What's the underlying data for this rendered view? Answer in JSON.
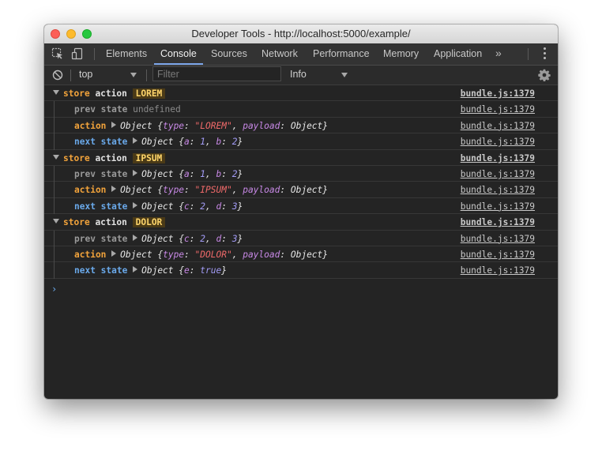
{
  "window": {
    "title": "Developer Tools - http://localhost:5000/example/"
  },
  "tabs": [
    {
      "label": "Elements"
    },
    {
      "label": "Console"
    },
    {
      "label": "Sources"
    },
    {
      "label": "Network"
    },
    {
      "label": "Performance"
    },
    {
      "label": "Memory"
    },
    {
      "label": "Application"
    }
  ],
  "active_tab": "Console",
  "icons": {
    "inspect": "cursor-inspect-icon",
    "device": "device-toggle-icon",
    "more_tabs": "chevron-double-right-icon",
    "menu": "kebab-menu-icon",
    "clear": "clear-console-icon",
    "settings": "gear-icon"
  },
  "filterbar": {
    "context": "top",
    "filter_placeholder": "Filter",
    "level": "Info"
  },
  "groups": [
    {
      "store": "store",
      "action": "action",
      "name": "LOREM",
      "source": "bundle.js:1379",
      "prev_label": "prev state",
      "prev_value": "undefined",
      "prev_source": "bundle.js:1379",
      "action_label": "action",
      "action_type": "\"LOREM\"",
      "action_source": "bundle.js:1379",
      "next_label": "next state",
      "next_source": "bundle.js:1379"
    },
    {
      "store": "store",
      "action": "action",
      "name": "IPSUM",
      "source": "bundle.js:1379",
      "prev_label": "prev state",
      "prev_source": "bundle.js:1379",
      "action_label": "action",
      "action_type": "\"IPSUM\"",
      "action_source": "bundle.js:1379",
      "next_label": "next state",
      "next_source": "bundle.js:1379"
    },
    {
      "store": "store",
      "action": "action",
      "name": "DOLOR",
      "source": "bundle.js:1379",
      "prev_label": "prev state",
      "prev_source": "bundle.js:1379",
      "action_label": "action",
      "action_type": "\"DOLOR\"",
      "action_source": "bundle.js:1379",
      "next_label": "next state",
      "next_source": "bundle.js:1379"
    }
  ],
  "tokens": {
    "object": "Object",
    "brace_open": "{",
    "brace_close": "}",
    "colon": ":",
    "comma": ",",
    "type_key": "type",
    "payload_key": "payload",
    "a": "a",
    "b": "b",
    "c": "c",
    "d": "d",
    "e": "e",
    "one": "1",
    "two": "2",
    "three": "3",
    "true": "true"
  },
  "prompt": "›",
  "colors": {
    "background": "#242424",
    "accent": "#7aa4e8",
    "label_orange": "#f2a33b",
    "label_blue": "#6aa9ea",
    "badge": "#ffd66b",
    "string": "#f06a6a",
    "key": "#c889e6",
    "number": "#a29bf5"
  }
}
